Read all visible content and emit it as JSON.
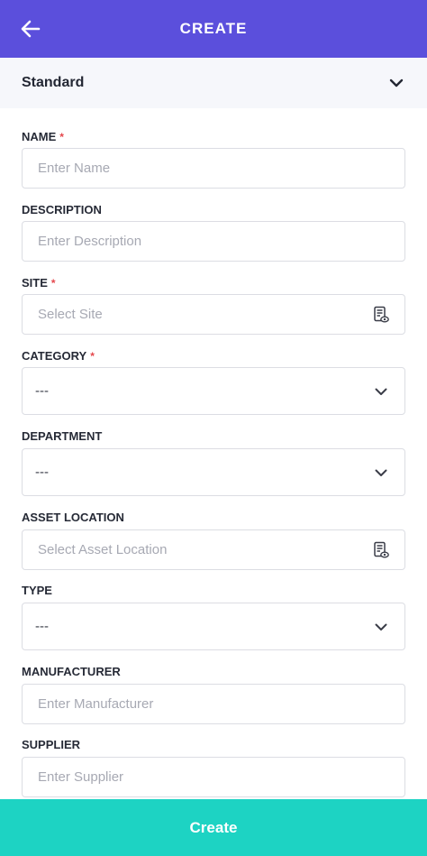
{
  "header": {
    "title": "CREATE",
    "back_icon": "arrow-left-icon",
    "background": "#5b4fdc"
  },
  "type_selector": {
    "value": "Standard",
    "icon": "chevron-down-icon",
    "background": "#f6f7fb"
  },
  "fields": {
    "name": {
      "label": "NAME",
      "required_mark": "*",
      "placeholder": "Enter Name"
    },
    "description": {
      "label": "DESCRIPTION",
      "placeholder": "Enter Description"
    },
    "site": {
      "label": "SITE",
      "required_mark": "*",
      "placeholder": "Select Site",
      "icon": "list-view-icon"
    },
    "category": {
      "label": "CATEGORY",
      "required_mark": "*",
      "value": "---",
      "icon": "chevron-down-icon"
    },
    "department": {
      "label": "DEPARTMENT",
      "value": "---",
      "icon": "chevron-down-icon"
    },
    "asset_location": {
      "label": "ASSET LOCATION",
      "placeholder": "Select Asset Location",
      "icon": "list-view-icon"
    },
    "type": {
      "label": "TYPE",
      "value": "---",
      "icon": "chevron-down-icon"
    },
    "manufacturer": {
      "label": "MANUFACTURER",
      "placeholder": "Enter Manufacturer"
    },
    "supplier": {
      "label": "SUPPLIER",
      "placeholder": "Enter Supplier"
    }
  },
  "footer": {
    "create_label": "Create",
    "background": "#1dd3c3"
  },
  "colors": {
    "required": "#e5484d",
    "border": "#dcdde3",
    "placeholder": "#a7a9b3"
  }
}
